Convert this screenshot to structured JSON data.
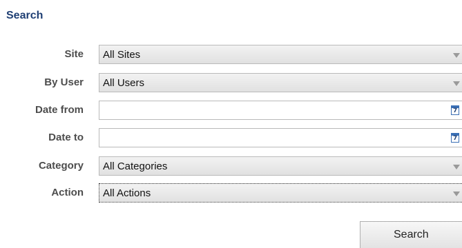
{
  "search": {
    "title": "Search",
    "fields": {
      "site": {
        "label": "Site",
        "value": "All Sites"
      },
      "by_user": {
        "label": "By User",
        "value": "All Users"
      },
      "date_from": {
        "label": "Date from",
        "value": "",
        "calendar_icon": "calendar-icon",
        "calendar_day": "7"
      },
      "date_to": {
        "label": "Date to",
        "value": "",
        "calendar_icon": "calendar-icon",
        "calendar_day": "7"
      },
      "category": {
        "label": "Category",
        "value": "All Categories"
      },
      "action": {
        "label": "Action",
        "value": "All Actions"
      }
    },
    "search_button_label": "Search"
  },
  "colors": {
    "title": "#1f3f74",
    "label": "#4d4d4d",
    "calendar_accent": "#3a6fb5"
  }
}
